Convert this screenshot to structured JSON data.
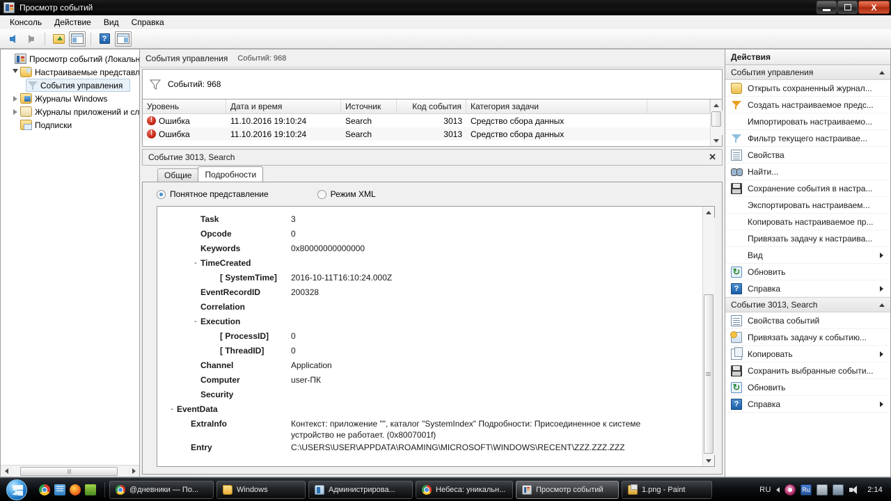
{
  "window": {
    "title": "Просмотр событий",
    "icon": "event-viewer-icon",
    "minimize": "",
    "maximize": "",
    "close": "X"
  },
  "menu": {
    "items": [
      {
        "label": "Консоль"
      },
      {
        "label": "Действие"
      },
      {
        "label": "Вид"
      },
      {
        "label": "Справка"
      }
    ]
  },
  "toolbar": {
    "buttons": [
      {
        "icon": "back-arrow-icon"
      },
      {
        "icon": "forward-arrow-icon"
      },
      {
        "icon": "folder-up-icon"
      },
      {
        "icon": "show-tree-pane-icon"
      },
      {
        "icon": "help-icon"
      },
      {
        "icon": "show-action-pane-icon"
      }
    ]
  },
  "tree": {
    "items": [
      {
        "label": "Просмотр событий (Локальнь",
        "icon": "event-viewer-icon",
        "indent": 0,
        "expander": "none"
      },
      {
        "label": "Настраиваемые представле",
        "icon": "folder-custom-icon",
        "indent": 1,
        "expander": "open"
      },
      {
        "label": "События управления",
        "icon": "funnel-icon",
        "indent": 2,
        "expander": "none",
        "selected": true
      },
      {
        "label": "Журналы Windows",
        "icon": "folder-windows-icon",
        "indent": 1,
        "expander": "closed"
      },
      {
        "label": "Журналы приложений и сл",
        "icon": "folder-apps-icon",
        "indent": 1,
        "expander": "closed"
      },
      {
        "label": "Подписки",
        "icon": "folder-subscriptions-icon",
        "indent": 1,
        "expander": "none"
      }
    ]
  },
  "center": {
    "header": {
      "title": "События управления",
      "count": "Событий: 968"
    },
    "filter": {
      "icon": "funnel-icon",
      "text": "Событий: 968"
    },
    "list": {
      "columns": [
        {
          "label": "Уровень",
          "key": "level"
        },
        {
          "label": "Дата и время",
          "key": "datetime"
        },
        {
          "label": "Источник",
          "key": "source"
        },
        {
          "label": "Код события",
          "key": "code"
        },
        {
          "label": "Категория задачи",
          "key": "category"
        }
      ],
      "rows": [
        {
          "level": "Ошибка",
          "level_icon": "error-icon",
          "datetime": "11.10.2016 19:10:24",
          "source": "Search",
          "code": "3013",
          "category": "Средство сбора данных"
        },
        {
          "level": "Ошибка",
          "level_icon": "error-icon",
          "datetime": "11.10.2016 19:10:24",
          "source": "Search",
          "code": "3013",
          "category": "Средство сбора данных"
        }
      ]
    }
  },
  "detail": {
    "title": "Событие 3013, Search",
    "close_label": "✕",
    "tabs": [
      {
        "label": "Общие",
        "active": false
      },
      {
        "label": "Подробности",
        "active": true
      }
    ],
    "view_modes": [
      {
        "label": "Понятное представление",
        "selected": true
      },
      {
        "label": "Режим XML",
        "selected": false
      }
    ],
    "properties": [
      {
        "name": "Task",
        "value": "3",
        "indent": 1,
        "expander": ""
      },
      {
        "name": "Opcode",
        "value": "0",
        "indent": 1,
        "expander": ""
      },
      {
        "name": "Keywords",
        "value": "0x80000000000000",
        "indent": 1,
        "expander": ""
      },
      {
        "name": "TimeCreated",
        "value": "",
        "indent": 1,
        "expander": "-"
      },
      {
        "name": "[ SystemTime]",
        "value": "2016-10-11T16:10:24.000Z",
        "indent": 2,
        "expander": ""
      },
      {
        "name": "EventRecordID",
        "value": "200328",
        "indent": 1,
        "expander": ""
      },
      {
        "name": "Correlation",
        "value": "",
        "indent": 1,
        "expander": ""
      },
      {
        "name": "Execution",
        "value": "",
        "indent": 1,
        "expander": "-"
      },
      {
        "name": "[ ProcessID]",
        "value": "0",
        "indent": 2,
        "expander": ""
      },
      {
        "name": "[ ThreadID]",
        "value": "0",
        "indent": 2,
        "expander": ""
      },
      {
        "name": "Channel",
        "value": "Application",
        "indent": 1,
        "expander": ""
      },
      {
        "name": "Computer",
        "value": "user-ПК",
        "indent": 1,
        "expander": ""
      },
      {
        "name": "Security",
        "value": "",
        "indent": 1,
        "expander": ""
      },
      {
        "name": "EventData",
        "value": "",
        "indent": 0,
        "expander": "-"
      },
      {
        "name": "ExtraInfo",
        "value": "Контекст: приложение \"\", каталог \"SystemIndex\" Подробности: Присоединенное к системе устройство не работает. (0x8007001f)",
        "indent": 1,
        "expander": "",
        "wrap": true
      },
      {
        "name": "Entry",
        "value": "C:\\USERS\\USER\\APPDATA\\ROAMING\\MICROSOFT\\WINDOWS\\RECENT\\ZZZ.ZZZ.ZZZ",
        "indent": 1,
        "expander": ""
      }
    ]
  },
  "actions": {
    "title": "Действия",
    "sections": [
      {
        "title": "События управления",
        "collapse_icon": "chevron-up-icon",
        "items": [
          {
            "label": "Открыть сохраненный журнал...",
            "icon": "open-log-icon",
            "submenu": false
          },
          {
            "label": "Создать настраиваемое предс...",
            "icon": "funnel-orange-icon",
            "submenu": false
          },
          {
            "label": "Импортировать настраиваемо...",
            "icon": "none",
            "submenu": false
          },
          {
            "label": "Фильтр текущего настраивае...",
            "icon": "funnel-blue-icon",
            "submenu": false
          },
          {
            "label": "Свойства",
            "icon": "properties-icon",
            "submenu": false
          },
          {
            "label": "Найти...",
            "icon": "find-icon",
            "submenu": false
          },
          {
            "label": "Сохранение события в настра...",
            "icon": "save-icon",
            "submenu": false
          },
          {
            "label": "Экспортировать настраиваем...",
            "icon": "none",
            "submenu": false
          },
          {
            "label": "Копировать настраиваемое пр...",
            "icon": "none",
            "submenu": false
          },
          {
            "label": "Привязать задачу к настраива...",
            "icon": "none",
            "submenu": false
          },
          {
            "label": "Вид",
            "icon": "none",
            "submenu": true
          },
          {
            "label": "Обновить",
            "icon": "refresh-icon",
            "submenu": false
          },
          {
            "label": "Справка",
            "icon": "help-icon",
            "submenu": true
          }
        ]
      },
      {
        "title": "Событие 3013, Search",
        "collapse_icon": "chevron-up-icon",
        "items": [
          {
            "label": "Свойства событий",
            "icon": "properties-icon",
            "submenu": false
          },
          {
            "label": "Привязать задачу к событию...",
            "icon": "attach-task-icon",
            "submenu": false
          },
          {
            "label": "Копировать",
            "icon": "copy-icon",
            "submenu": true
          },
          {
            "label": "Сохранить выбранные событи...",
            "icon": "save-icon",
            "submenu": false
          },
          {
            "label": "Обновить",
            "icon": "refresh-icon",
            "submenu": false
          },
          {
            "label": "Справка",
            "icon": "help-icon",
            "submenu": true
          }
        ]
      }
    ]
  },
  "taskbar": {
    "start": "start-orb",
    "quicklaunch": [
      {
        "icon": "chrome-icon"
      },
      {
        "icon": "document-icon"
      },
      {
        "icon": "firefox-icon"
      },
      {
        "icon": "rdp-icon"
      }
    ],
    "tasks": [
      {
        "label": "@дневники — По...",
        "icon": "chrome-icon",
        "active": false
      },
      {
        "label": "Windows",
        "icon": "folder-icon",
        "active": false
      },
      {
        "label": "Администрирова...",
        "icon": "admin-tools-icon",
        "active": false
      },
      {
        "label": "Небеса: уникальн...",
        "icon": "chrome-icon",
        "active": false
      },
      {
        "label": "Просмотр событий",
        "icon": "event-viewer-icon",
        "active": true
      },
      {
        "label": "1.png - Paint",
        "icon": "paint-icon",
        "active": false
      }
    ],
    "tray": {
      "language": "RU",
      "chevron": "show-hidden-icons",
      "icons": [
        {
          "icon": "opera-icon"
        },
        {
          "icon": "ru-layout-icon",
          "label": "Ru"
        },
        {
          "icon": "battery-icon"
        },
        {
          "icon": "network-icon"
        },
        {
          "icon": "volume-icon"
        }
      ],
      "clock": "2:14"
    }
  }
}
